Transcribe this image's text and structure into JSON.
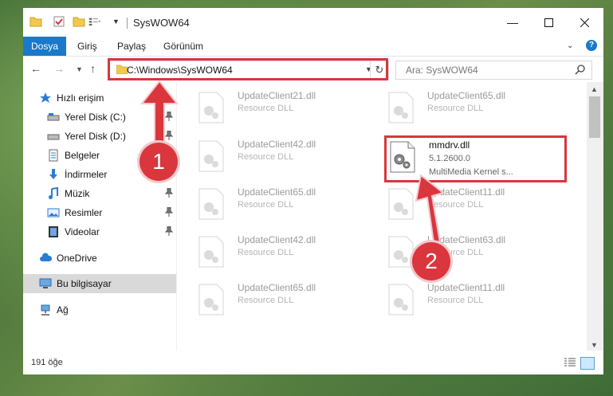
{
  "window": {
    "title": "SysWOW64"
  },
  "ribbon": {
    "file_tab": "Dosya",
    "tabs": [
      "Giriş",
      "Paylaş",
      "Görünüm"
    ]
  },
  "navigation": {
    "address": "C:\\Windows\\SysWOW64",
    "search_placeholder": "Ara: SysWOW64"
  },
  "sidebar": {
    "items": [
      {
        "label": "Hızlı erişim",
        "icon": "star-icon"
      },
      {
        "label": "Yerel Disk (C:)",
        "icon": "drive-icon"
      },
      {
        "label": "Yerel Disk (D:)",
        "icon": "drive-icon"
      },
      {
        "label": "Belgeler",
        "icon": "documents-icon"
      },
      {
        "label": "İndirmeler",
        "icon": "download-icon"
      },
      {
        "label": "Müzik",
        "icon": "music-icon"
      },
      {
        "label": "Resimler",
        "icon": "pictures-icon"
      },
      {
        "label": "Videolar",
        "icon": "video-icon"
      },
      {
        "label": "OneDrive",
        "icon": "cloud-icon"
      },
      {
        "label": "Bu bilgisayar",
        "icon": "computer-icon"
      },
      {
        "label": "Ağ",
        "icon": "network-icon"
      }
    ]
  },
  "files": {
    "faded": [
      {
        "name": "UpdateClient21.dll",
        "desc": "Resource DLL"
      },
      {
        "name": "UpdateClient65.dll",
        "desc": "Resource DLL"
      },
      {
        "name": "UpdateClient42.dll",
        "desc": "Resource DLL"
      },
      {
        "name": "UpdateClient65.dll",
        "desc": "Resource DLL"
      },
      {
        "name": "UpdateClient11.dll",
        "desc": "Resource DLL"
      },
      {
        "name": "UpdateClient42.dll",
        "desc": "Resource DLL"
      },
      {
        "name": "UpdateClient63.dll",
        "desc": "Resource DLL"
      },
      {
        "name": "UpdateClient65.dll",
        "desc": "Resource DLL"
      },
      {
        "name": "UpdateClient11.dll",
        "desc": "Resource DLL"
      }
    ],
    "highlighted": {
      "name": "mmdrv.dll",
      "version": "5.1.2600.0",
      "desc": "MultiMedia Kernel s..."
    }
  },
  "status": {
    "count": "191 öğe"
  },
  "annotations": {
    "step1": "1",
    "step2": "2",
    "color": "#d9363e"
  }
}
